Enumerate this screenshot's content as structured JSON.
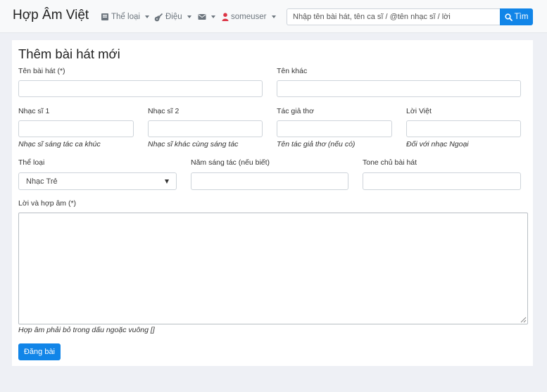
{
  "brand": "Hợp Âm Việt",
  "nav": {
    "genres": {
      "label": "Thể loại",
      "icon": "book-icon"
    },
    "rhythm": {
      "label": "Điệu",
      "icon": "guitar-icon"
    },
    "messages": {
      "icon": "envelope-icon"
    },
    "user": {
      "label": "someuser",
      "icon": "user-icon",
      "icon_color": "#dc3545"
    }
  },
  "search": {
    "placeholder": "Nhập tên bài hát, tên ca sĩ / @tên nhạc sĩ / lời",
    "value": "",
    "button_label": "Tìm"
  },
  "form": {
    "title": "Thêm bài hát mới",
    "song_name": {
      "label": "Tên bài hát (*)",
      "value": ""
    },
    "other_name": {
      "label": "Tên khác",
      "value": ""
    },
    "composer": {
      "label": "Nhạc sĩ 1",
      "value": "",
      "hint": "Nhạc sĩ sáng tác ca khúc"
    },
    "composer2": {
      "label": "Nhạc sĩ 2",
      "value": "",
      "hint": "Nhạc sĩ khác cùng sáng tác"
    },
    "poet": {
      "label": "Tác giả thơ",
      "value": "",
      "hint": "Tên tác giả thơ (nếu có)"
    },
    "viet_lyrics": {
      "label": "Lời Việt",
      "value": "",
      "hint": "Đối với nhạc Ngoại"
    },
    "genre": {
      "label": "Thể loại",
      "selected": "Nhạc Trẻ"
    },
    "year": {
      "label": "Năm sáng tác (nếu biết)",
      "value": ""
    },
    "tone": {
      "label": "Tone chủ bài hát",
      "value": ""
    },
    "lyrics": {
      "label": "Lời và hợp âm (*)",
      "value": "",
      "hint": "Hợp âm phải bỏ trong dấu ngoặc vuông []"
    },
    "submit_label": "Đăng bài"
  },
  "colors": {
    "accent": "#1185e8",
    "background": "#eef0f5",
    "card": "#ffffff"
  }
}
